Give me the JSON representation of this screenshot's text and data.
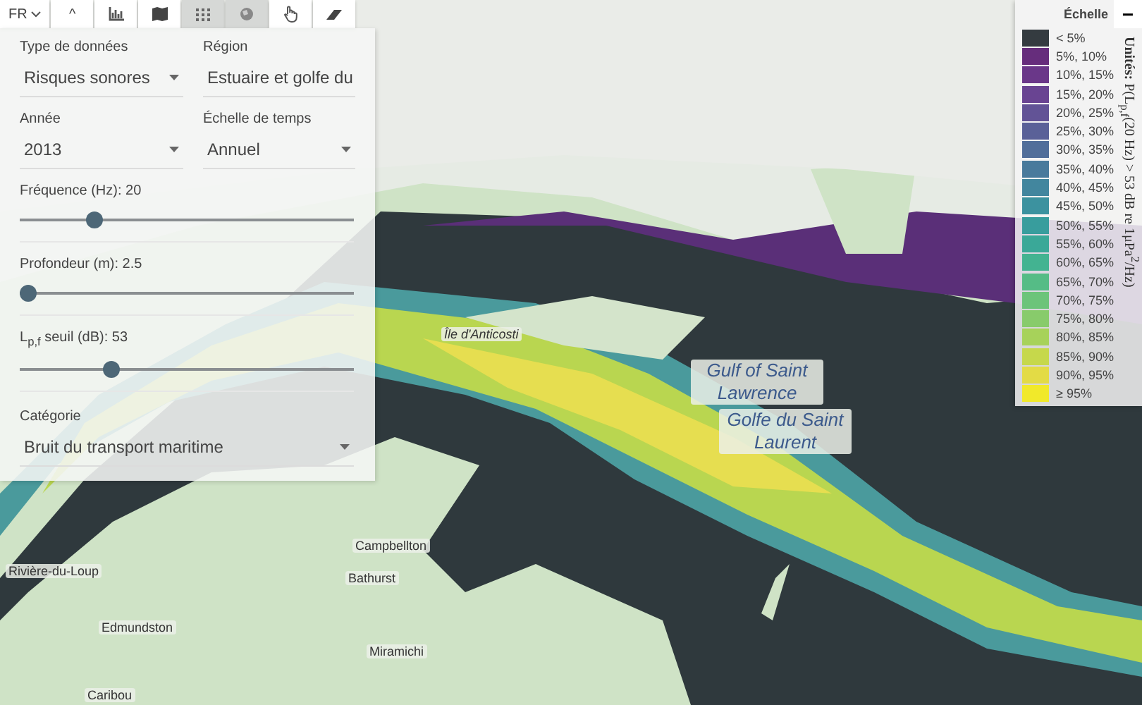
{
  "toolbar": {
    "language": "FR",
    "collapse": "^",
    "tools": [
      {
        "kind": "chart",
        "disabled": false
      },
      {
        "kind": "map",
        "disabled": false
      },
      {
        "kind": "grid",
        "disabled": true
      },
      {
        "kind": "globe",
        "disabled": true
      },
      {
        "kind": "hand",
        "disabled": false
      },
      {
        "kind": "eraser",
        "disabled": false
      }
    ]
  },
  "panel": {
    "selects": [
      {
        "label": "Type de données",
        "value": "Risques sonores"
      },
      {
        "label": "Région",
        "value": "Estuaire et golfe du"
      },
      {
        "label": "Année",
        "value": "2013"
      },
      {
        "label": "Échelle de temps",
        "value": "Annuel"
      }
    ],
    "sliders": [
      {
        "label": "Fréquence (Hz): 20",
        "level": 0.21
      },
      {
        "label": "Profondeur (m): 2.5",
        "level": 0
      },
      {
        "label": "L$_{p,f}$ seuil (dB): 53",
        "level": 0.26
      }
    ],
    "category": {
      "label": "Catégorie",
      "value": "Bruit du transport maritime"
    }
  },
  "map_labels": [
    {
      "kind": "island",
      "text": "Île d'Anticosti"
    },
    {
      "kind": "sea",
      "text": "Gulf of Saint Lawrence"
    },
    {
      "kind": "sea",
      "text": "Golfe du Saint Laurent"
    },
    {
      "kind": "city",
      "text": "Campbellton"
    },
    {
      "kind": "city",
      "text": "Bathurst"
    },
    {
      "kind": "city",
      "text": "Rivière-du-Loup"
    },
    {
      "kind": "city",
      "text": "Edmundston"
    },
    {
      "kind": "city",
      "text": "Miramichi"
    },
    {
      "kind": "city",
      "text": "Caribou"
    }
  ],
  "legend": {
    "title": "Échelle",
    "collapse": "−",
    "units": "**Unités:** P(L$_{p,f}$(20 Hz) > 53 dB re 1μPa$^{2}$/Hz)",
    "items": [
      {
        "label": "< 5%",
        "color": "#343b40"
      },
      {
        "label": "5%, 10%",
        "color": "#662d7c"
      },
      {
        "label": "10%, 15%",
        "color": "#6a3789"
      },
      {
        "label": "15%, 20%",
        "color": "#694492"
      },
      {
        "label": "20%, 25%",
        "color": "#625396"
      },
      {
        "label": "25%, 30%",
        "color": "#5a6198"
      },
      {
        "label": "30%, 35%",
        "color": "#516e9a"
      },
      {
        "label": "35%, 40%",
        "color": "#497a9c"
      },
      {
        "label": "40%, 45%",
        "color": "#42869e"
      },
      {
        "label": "45%, 50%",
        "color": "#3c929f"
      },
      {
        "label": "50%, 55%",
        "color": "#389d9d"
      },
      {
        "label": "55%, 60%",
        "color": "#3aa898"
      },
      {
        "label": "60%, 65%",
        "color": "#43b391"
      },
      {
        "label": "65%, 70%",
        "color": "#55bc86"
      },
      {
        "label": "70%, 75%",
        "color": "#6cc47a"
      },
      {
        "label": "75%, 80%",
        "color": "#88cb6b"
      },
      {
        "label": "80%, 85%",
        "color": "#a7d25a"
      },
      {
        "label": "85%, 90%",
        "color": "#c6d84b"
      },
      {
        "label": "90%, 95%",
        "color": "#e3db45"
      },
      {
        "label": "≥ 95%",
        "color": "#f1e92a"
      }
    ]
  }
}
